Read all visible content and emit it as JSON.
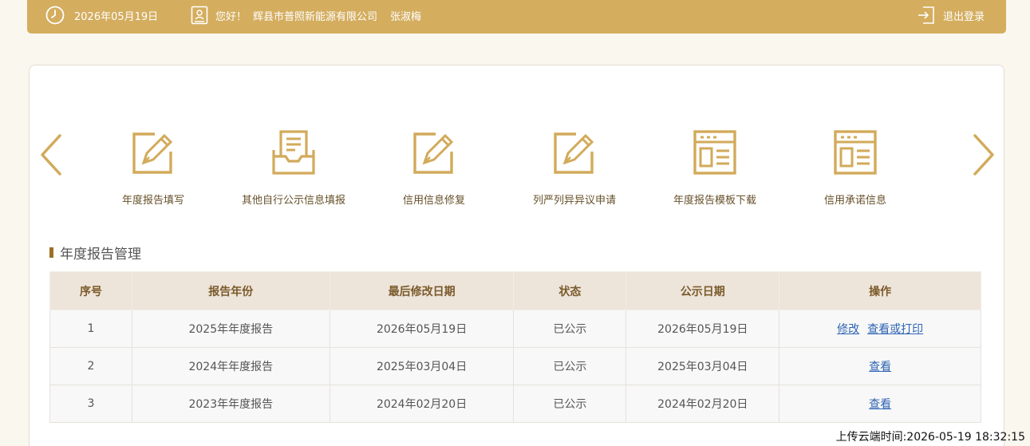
{
  "header": {
    "date": "2026年05月19日",
    "greeting": "您好！",
    "company": "辉县市普照新能源有限公司",
    "person": "张淑梅",
    "logout_label": "退出登录"
  },
  "functions": [
    {
      "label": "年度报告填写",
      "icon": "edit-document-icon"
    },
    {
      "label": "其他自行公示信息填报",
      "icon": "inbox-document-icon"
    },
    {
      "label": "信用信息修复",
      "icon": "edit-document-icon"
    },
    {
      "label": "列严列异异议申请",
      "icon": "edit-document-icon"
    },
    {
      "label": "年度报告模板下载",
      "icon": "template-icon"
    },
    {
      "label": "信用承诺信息",
      "icon": "template-icon"
    }
  ],
  "section": {
    "title": "年度报告管理"
  },
  "table": {
    "headers": [
      "序号",
      "报告年份",
      "最后修改日期",
      "状态",
      "公示日期",
      "操作"
    ],
    "rows": [
      {
        "no": "1",
        "year": "2025年年度报告",
        "modified": "2026年05月19日",
        "status": "已公示",
        "published": "2026年05月19日",
        "actions": [
          "修改",
          "查看或打印"
        ]
      },
      {
        "no": "2",
        "year": "2024年年度报告",
        "modified": "2025年03月04日",
        "status": "已公示",
        "published": "2025年03月04日",
        "actions": [
          "查看"
        ]
      },
      {
        "no": "3",
        "year": "2023年年度报告",
        "modified": "2024年02月20日",
        "status": "已公示",
        "published": "2024年02月20日",
        "actions": [
          "查看"
        ]
      }
    ]
  },
  "upload_stamp": "上传云端时间:2026-05-19 18:32:15",
  "colors": {
    "accent": "#d4ad5f",
    "icon": "#d2aa5a",
    "link": "#2f64b4"
  }
}
